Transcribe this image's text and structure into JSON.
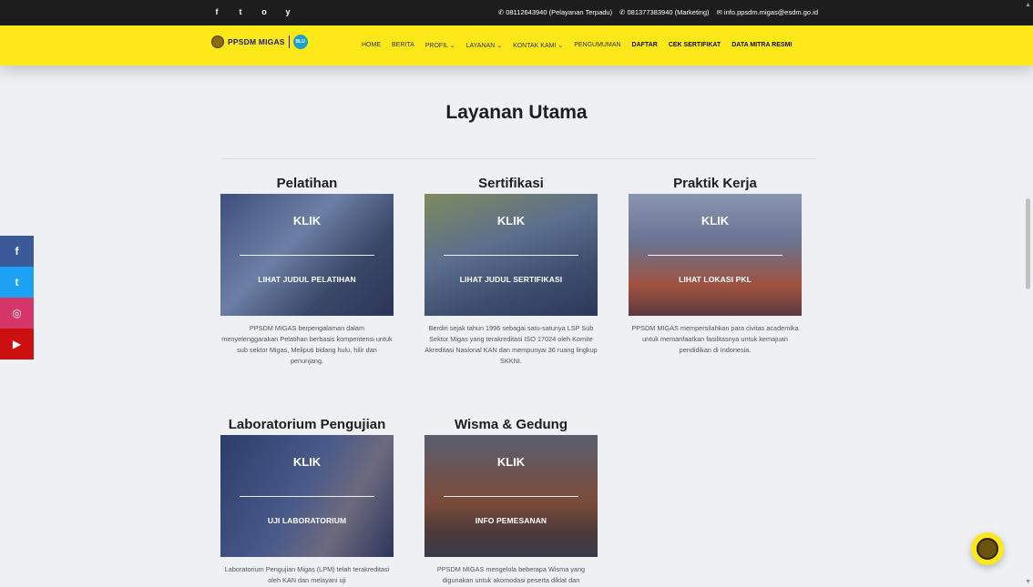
{
  "topbar": {
    "socials": [
      "f",
      "t",
      "o",
      "y"
    ],
    "phone1": "✆ 08112643940 (Pelayanan Terpadu)",
    "phone2": "✆ 081377383940 (Marketing)",
    "email": "✉ info.ppsdm.migas@esdm.go.id"
  },
  "logo": {
    "brand": "PPSDM MIGAS",
    "badge": "BLU"
  },
  "nav": {
    "items": [
      "HOME",
      "BERITA",
      "PROFIL ⌄",
      "LAYANAN ⌄",
      "KONTAK KAMI ⌄",
      "PENGUMUMAN",
      "DAFTAR",
      "CEK SERTIFIKAT",
      "DATA MITRA RESMI"
    ]
  },
  "side_social": [
    "f",
    "t",
    "◎",
    "▶"
  ],
  "main": {
    "heading": "Layanan Utama",
    "cards": [
      {
        "title": "Pelatihan",
        "klik": "KLIK",
        "sub": "LIHAT JUDUL PELATIHAN",
        "desc": "PPSDM MIGAS berpengalaman dalam menyelenggarakan Pelatihan berbasis kompentensi untuk sub sektor Migas, Meliputi bidang hulu, hilir dan penunjang."
      },
      {
        "title": "Sertifikasi",
        "klik": "KLIK",
        "sub": "LIHAT JUDUL SERTIFIKASI",
        "desc": "Berdiri sejak tahun 1996 sebagai satu-satunya LSP Sub Sektor Migas yang terakreditasi ISO 17024 oleh Komite Akreditasi Nasional KAN dan mempunyai 36 ruang lingkup SKKNI."
      },
      {
        "title": "Praktik Kerja",
        "klik": "KLIK",
        "sub": "LIHAT LOKASI PKL",
        "desc": "PPSDM MIGAS mempersilahkan para civitas academika untuk memanfaatkan fasilitasnya untuk kemajuan pendidikan di Indonesia."
      },
      {
        "title": "Laboratorium Pengujian",
        "klik": "KLIK",
        "sub": "UJI LABORATORIUM",
        "desc": "Laboratorium Pengujian Migas (LPM) telah terakreditasi oleh KAN dan melayani uji"
      },
      {
        "title": "Wisma & Gedung",
        "klik": "KLIK",
        "sub": "INFO PEMESANAN",
        "desc": "PPSDM MIGAS mengelola beberapa Wisma yang digunakan untuk akomodasi peserta diklat dan"
      }
    ]
  }
}
